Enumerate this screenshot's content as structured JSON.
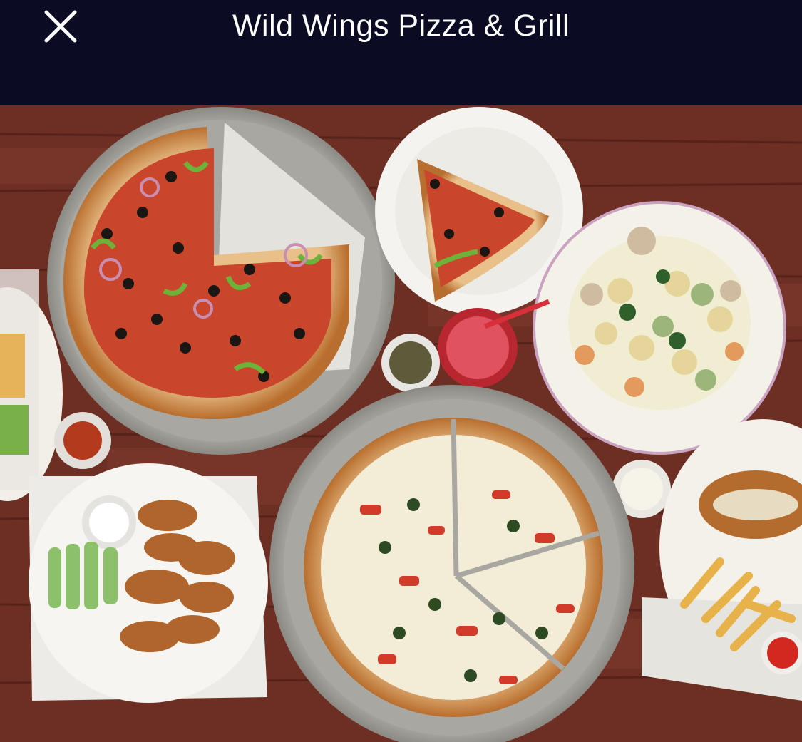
{
  "header": {
    "title": "Wild Wings Pizza & Grill",
    "close_icon": "close-icon",
    "background": "#0b0c24",
    "text_color": "#ffffff"
  },
  "photo": {
    "subject": "food-photo"
  }
}
